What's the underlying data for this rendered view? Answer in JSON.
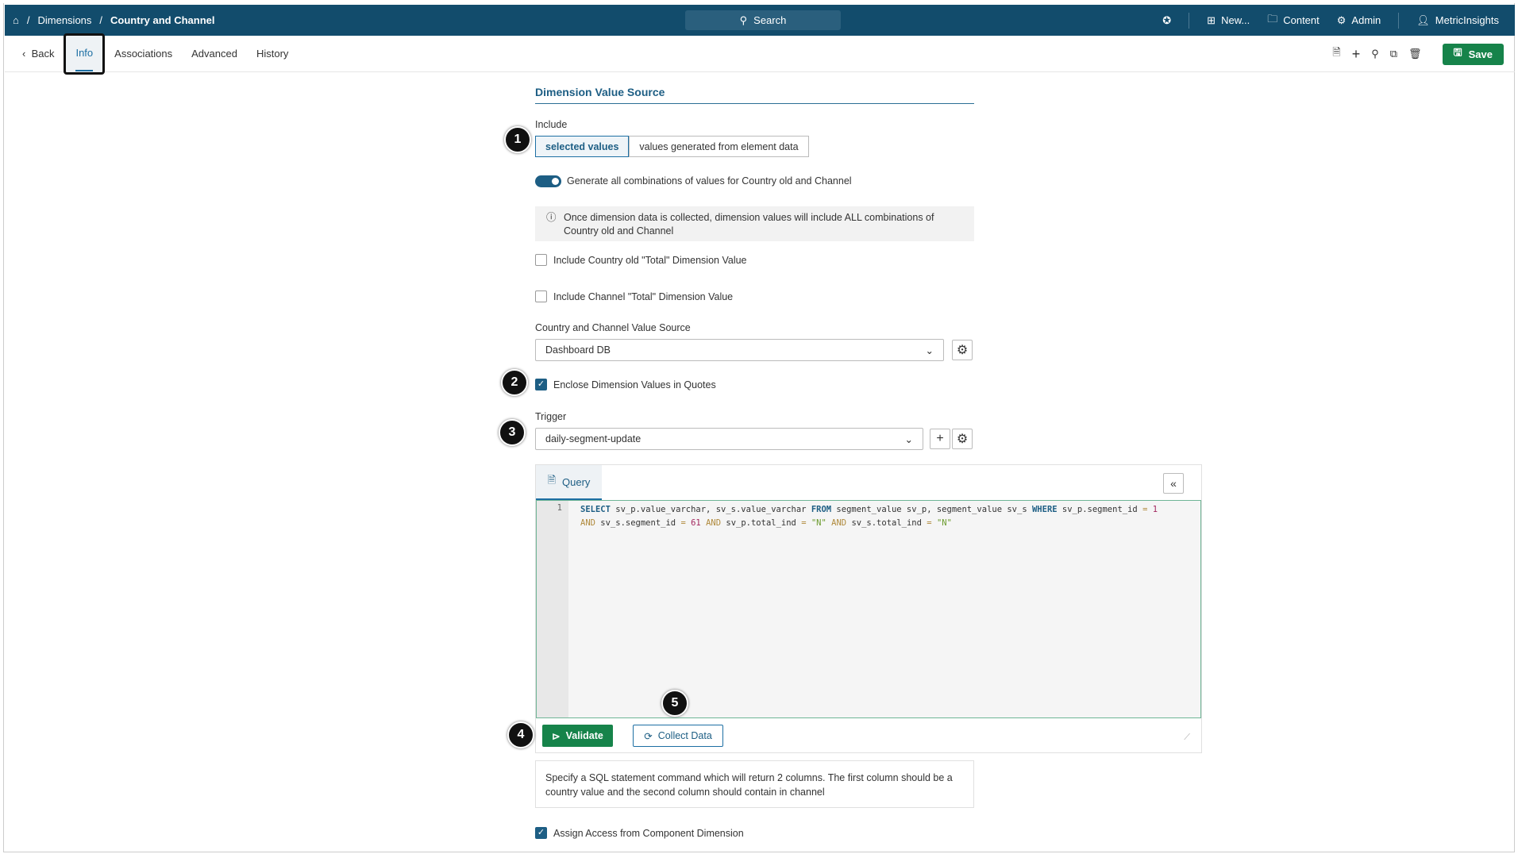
{
  "topbar": {
    "crumbs": [
      "Dimensions",
      "Country and Channel"
    ],
    "search": "Search",
    "new": "New...",
    "content": "Content",
    "admin": "Admin",
    "user": "MetricInsights"
  },
  "subnav": {
    "back": "Back",
    "tabs": [
      "Info",
      "Associations",
      "Advanced",
      "History"
    ],
    "save": "Save"
  },
  "form": {
    "section_title": "Dimension Value Source",
    "include_label": "Include",
    "include_options": [
      "selected values",
      "values generated from element data"
    ],
    "toggle_label": "Generate all combinations of values for Country old and Channel",
    "toggle_on": true,
    "info_text": "Once dimension data is collected, dimension values will include ALL combinations of Country old and Channel",
    "total1": "Include Country old \"Total\" Dimension Value",
    "total2": "Include Channel \"Total\" Dimension Value",
    "source_label": "Country and Channel Value Source",
    "source_value": "Dashboard DB",
    "enclose_label": "Enclose Dimension Values in Quotes",
    "trigger_label": "Trigger",
    "trigger_value": "daily-segment-update",
    "query_tab": "Query",
    "line_number": "1",
    "validate": "Validate",
    "collect": "Collect Data",
    "help": "Specify a SQL statement command which will return 2 columns. The first column should be a country value and the second column should contain in channel",
    "assign": "Assign Access from Component Dimension"
  },
  "badges": [
    "1",
    "2",
    "3",
    "4",
    "5"
  ]
}
